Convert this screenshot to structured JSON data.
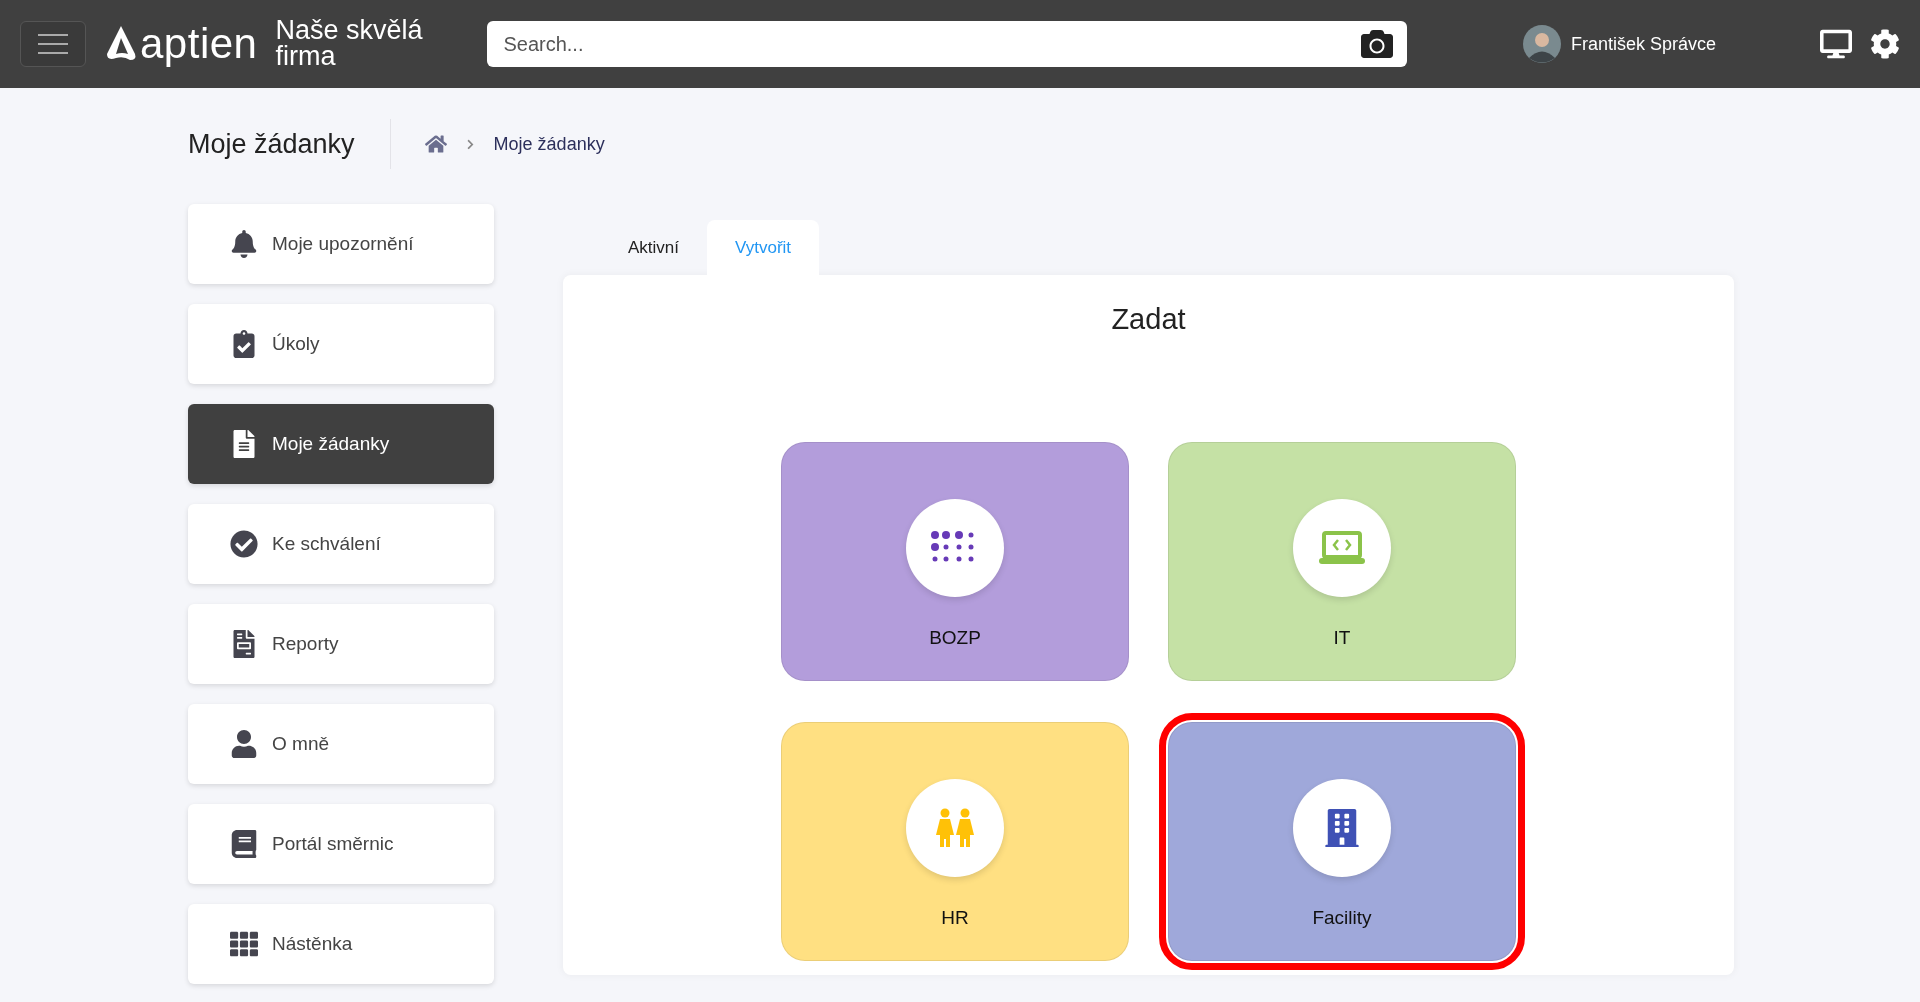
{
  "header": {
    "logo": "aptien",
    "company": "Naše skvělá firma",
    "search": {
      "placeholder": "Search..."
    },
    "user": "František Správce"
  },
  "page_title": "Moje žádanky",
  "breadcrumb": [
    "Moje žádanky"
  ],
  "sidebar": {
    "items": [
      {
        "label": "Moje upozornění",
        "selected": false
      },
      {
        "label": "Úkoly",
        "selected": false
      },
      {
        "label": "Moje žádanky",
        "selected": true
      },
      {
        "label": "Ke schválení",
        "selected": false
      },
      {
        "label": "Reporty",
        "selected": false
      },
      {
        "label": "O mně",
        "selected": false
      },
      {
        "label": "Portál směrnic",
        "selected": false
      },
      {
        "label": "Nástěnka",
        "selected": false
      }
    ]
  },
  "tabs": [
    {
      "label": "Aktivní",
      "selected": false
    },
    {
      "label": "Vytvořit",
      "selected": true
    }
  ],
  "panel": {
    "title": "Zadat",
    "categories": [
      {
        "label": "BOZP",
        "color": "#b39ddb",
        "highlighted": false
      },
      {
        "label": "IT",
        "color": "#c5e1a5",
        "highlighted": false
      },
      {
        "label": "HR",
        "color": "#ffe082",
        "highlighted": false
      },
      {
        "label": "Facility",
        "color": "#9fa8da",
        "highlighted": true
      }
    ]
  }
}
